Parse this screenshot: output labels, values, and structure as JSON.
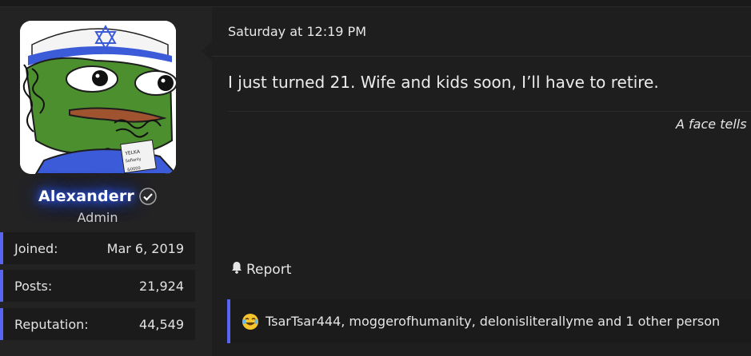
{
  "user": {
    "name": "Alexanderr",
    "title": "Admin",
    "avatar": "pepe-frog-avatar",
    "stats": [
      {
        "label": "Joined:",
        "value": "Mar 6, 2019"
      },
      {
        "label": "Posts:",
        "value": "21,924"
      },
      {
        "label": "Reputation:",
        "value": "44,549"
      }
    ]
  },
  "post": {
    "date": "Saturday at 12:19 PM",
    "message": "I just turned 21. Wife and kids soon, I’ll have to retire.",
    "signature": "A face tells r",
    "report_label": "Report"
  },
  "reactions": {
    "emoji": "crying-laughing-emoji",
    "text": "TsarTsar444, moggerofhumanity, delonisliterallyme and 1 other person"
  },
  "colors": {
    "accent": "#5865f2",
    "glow": "#2f5dff",
    "background": "#1e1e1f",
    "panel": "#232324"
  }
}
